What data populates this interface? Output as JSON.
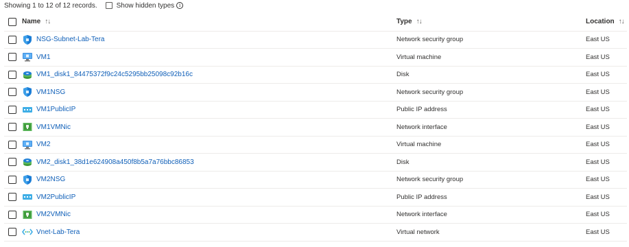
{
  "toolbar": {
    "records_text": "Showing 1 to 12 of 12 records.",
    "show_hidden_label": "Show hidden types",
    "info_glyph": "i"
  },
  "columns": {
    "name": "Name",
    "type": "Type",
    "location": "Location",
    "name_sort_glyph": "↑↓",
    "type_sort_glyph": "↑↓",
    "location_sort_glyph": "↑↓"
  },
  "rows": [
    {
      "name": "NSG-Subnet-Lab-Tera",
      "type": "Network security group",
      "location": "East US",
      "icon": "nsg-icon"
    },
    {
      "name": "VM1",
      "type": "Virtual machine",
      "location": "East US",
      "icon": "vm-icon"
    },
    {
      "name": "VM1_disk1_84475372f9c24c5295bb25098c92b16c",
      "type": "Disk",
      "location": "East US",
      "icon": "disk-icon"
    },
    {
      "name": "VM1NSG",
      "type": "Network security group",
      "location": "East US",
      "icon": "nsg-icon"
    },
    {
      "name": "VM1PublicIP",
      "type": "Public IP address",
      "location": "East US",
      "icon": "public-ip-icon"
    },
    {
      "name": "VM1VMNic",
      "type": "Network interface",
      "location": "East US",
      "icon": "nic-icon"
    },
    {
      "name": "VM2",
      "type": "Virtual machine",
      "location": "East US",
      "icon": "vm-icon"
    },
    {
      "name": "VM2_disk1_38d1e624908a450f8b5a7a76bbc86853",
      "type": "Disk",
      "location": "East US",
      "icon": "disk-icon"
    },
    {
      "name": "VM2NSG",
      "type": "Network security group",
      "location": "East US",
      "icon": "nsg-icon"
    },
    {
      "name": "VM2PublicIP",
      "type": "Public IP address",
      "location": "East US",
      "icon": "public-ip-icon"
    },
    {
      "name": "VM2VMNic",
      "type": "Network interface",
      "location": "East US",
      "icon": "nic-icon"
    },
    {
      "name": "Vnet-Lab-Tera",
      "type": "Virtual network",
      "location": "East US",
      "icon": "vnet-icon"
    }
  ],
  "colors": {
    "link": "#0f5fb8",
    "border": "#edebe9"
  }
}
